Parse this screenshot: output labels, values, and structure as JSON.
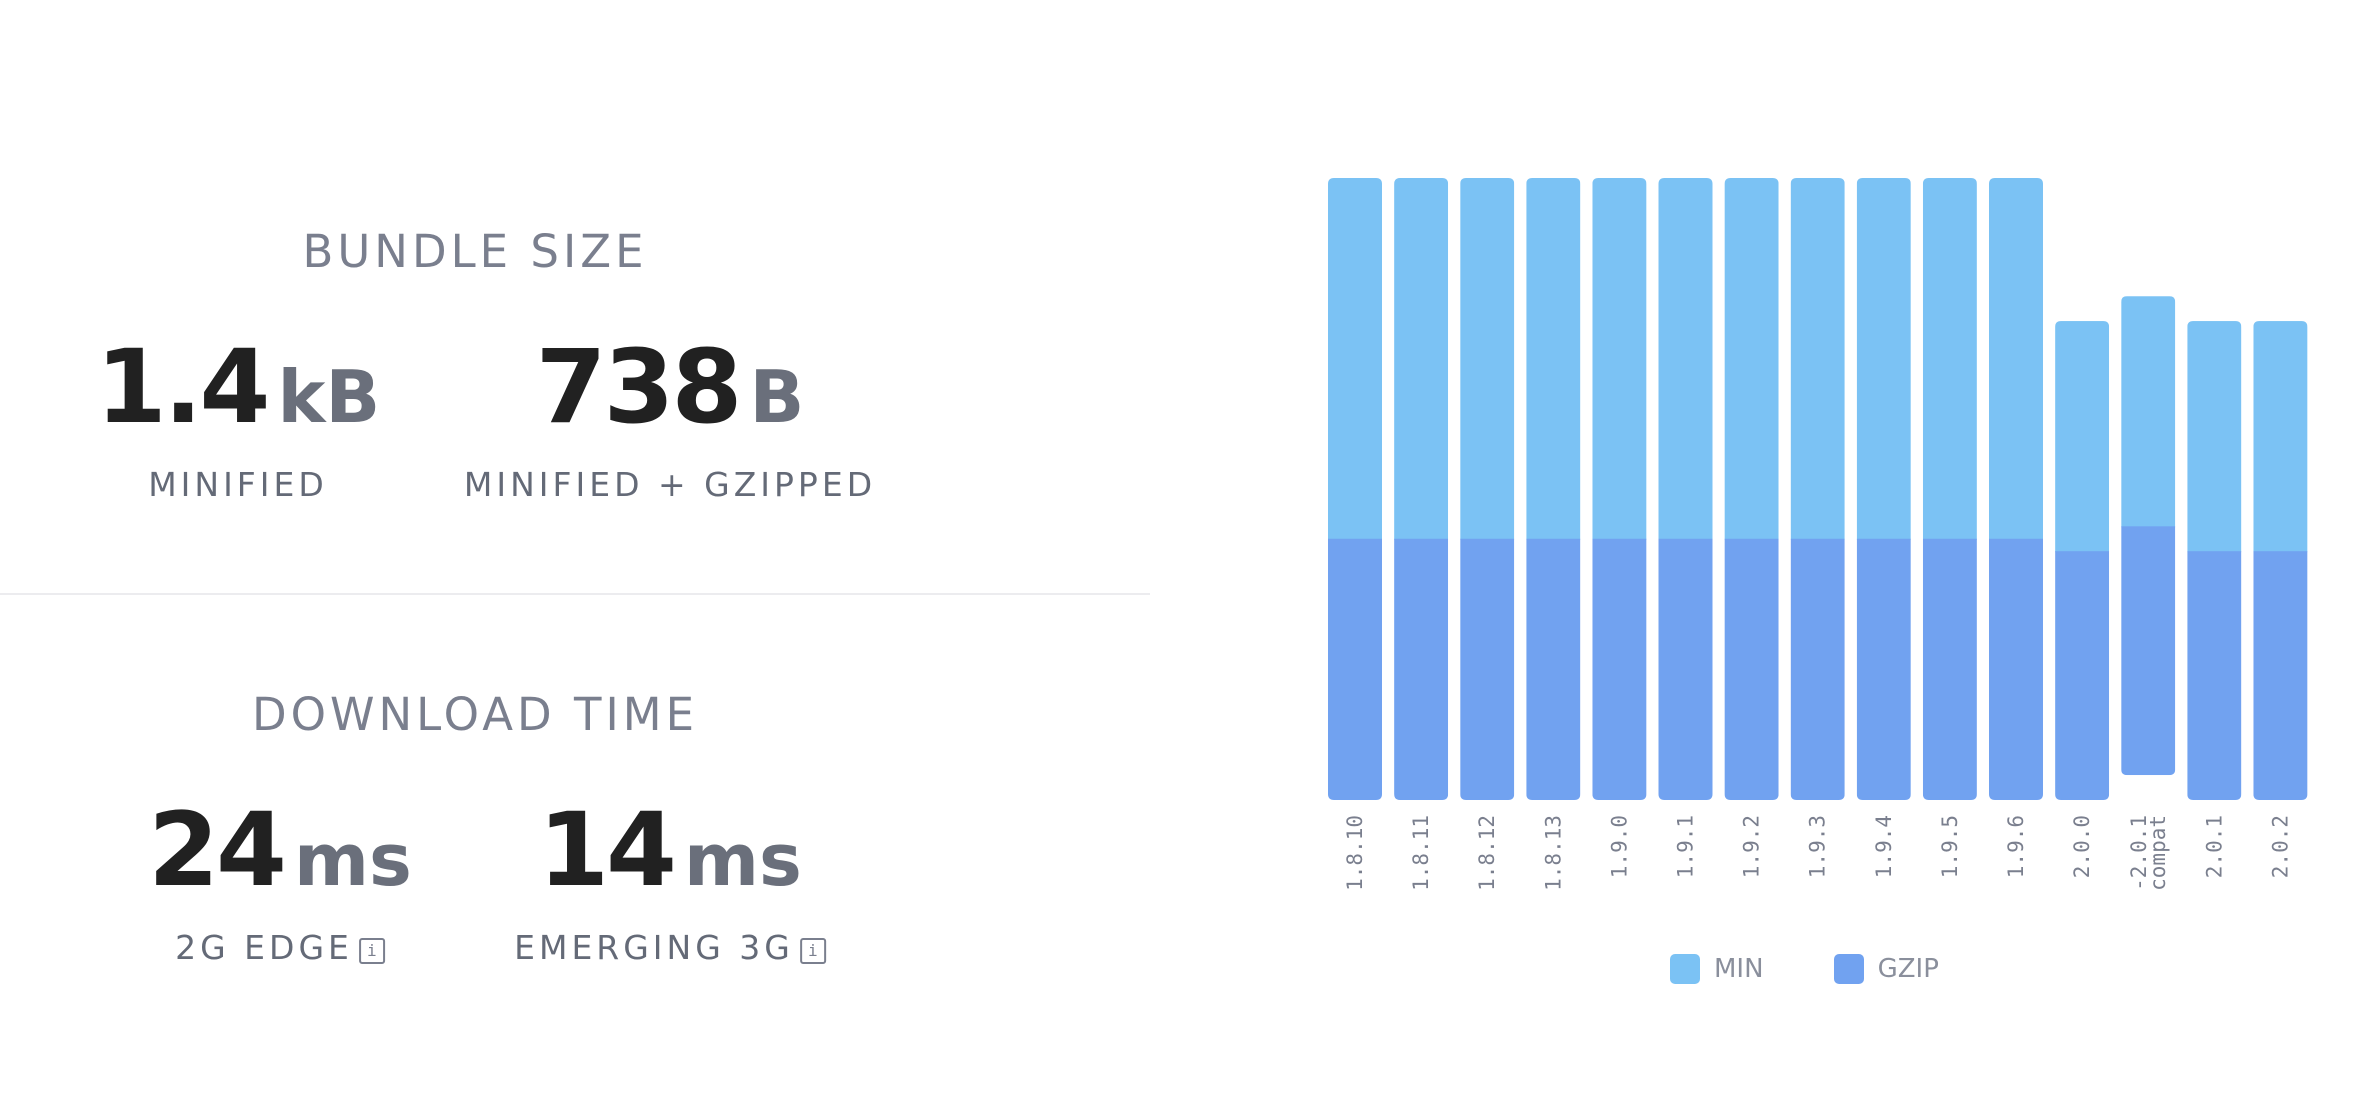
{
  "bundle_size": {
    "title": "BUNDLE SIZE",
    "minified": {
      "number": "1.4",
      "unit": "kB",
      "label": "MINIFIED"
    },
    "gzipped": {
      "number": "738",
      "unit": "B",
      "label": "MINIFIED + GZIPPED"
    }
  },
  "download_time": {
    "title": "DOWNLOAD TIME",
    "edge_2g": {
      "number": "24",
      "unit": "ms",
      "label": "2G EDGE",
      "info_icon": "info-icon"
    },
    "emerging_3g": {
      "number": "14",
      "unit": "ms",
      "label": "EMERGING 3G",
      "info_icon": "info-icon"
    }
  },
  "legend": {
    "min_label": "MIN",
    "gzip_label": "GZIP"
  },
  "colors": {
    "min": "#7bc2f4",
    "gzip": "#71a2f0"
  },
  "chart_data": {
    "type": "bar",
    "stacked": true,
    "categories": [
      "1.8.10",
      "1.8.11",
      "1.8.12",
      "1.8.13",
      "1.9.0",
      "1.9.1",
      "1.9.2",
      "1.9.3",
      "1.9.4",
      "1.9.5",
      "1.9.6",
      "2.0.0",
      "2.0.1-compat",
      "2.0.1",
      "2.0.2"
    ],
    "series": [
      {
        "name": "GZIP",
        "values": [
          0.42,
          0.42,
          0.42,
          0.42,
          0.42,
          0.42,
          0.42,
          0.42,
          0.42,
          0.42,
          0.42,
          0.4,
          0.4,
          0.4,
          0.4
        ]
      },
      {
        "name": "MIN",
        "values": [
          0.58,
          0.58,
          0.58,
          0.58,
          0.58,
          0.58,
          0.58,
          0.58,
          0.58,
          0.58,
          0.58,
          0.37,
          0.37,
          0.37,
          0.37
        ]
      }
    ],
    "offsets": [
      0,
      0,
      0,
      0,
      0,
      0,
      0,
      0,
      0,
      0,
      0,
      0,
      0.04,
      0,
      0
    ],
    "ylim": [
      0,
      1
    ],
    "grid": false,
    "legend_position": "bottom-center"
  }
}
